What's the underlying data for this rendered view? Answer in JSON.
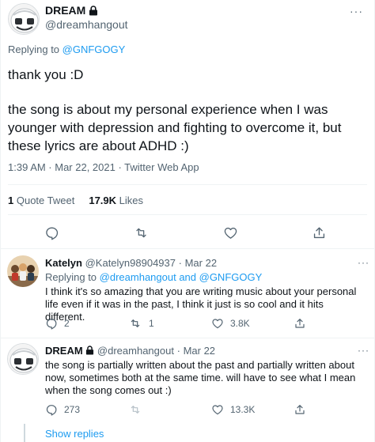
{
  "main_tweet": {
    "author": {
      "display_name": "DREAM",
      "handle": "@dreamhangout",
      "protected_icon": "lock-icon",
      "avatar_icon": "dream-smiley-mask-avatar"
    },
    "more_icon": "more-dots-icon",
    "more_label": "···",
    "replying_prefix": "Replying to",
    "replying_to": "@GNFGOGY",
    "text_line1": "thank you :D",
    "text_line2": "the song is about my personal experience when I was younger with depression and fighting to overcome it, but these lyrics are about ADHD :)",
    "timestamp": "1:39 AM · Mar 22, 2021 · Twitter Web App",
    "stats": {
      "quote_count": "1",
      "quote_label": "Quote Tweet",
      "like_count": "17.9K",
      "like_label": "Likes"
    },
    "actions": [
      "reply-icon",
      "retweet-icon",
      "like-icon",
      "share-icon"
    ]
  },
  "replies": [
    {
      "display_name": "Katelyn",
      "handle": "@Katelyn98904937",
      "sep": "·",
      "date": "Mar 22",
      "replying_prefix": "Replying to",
      "replying_to": "@dreamhangout and @GNFGOGY",
      "text": "I think it's so amazing that you are writing music about your personal life even if it was in the past, I think it just is so cool and it hits different.",
      "more_label": "···",
      "reply_count": "2",
      "retweet_count": "1",
      "like_count": "3.8K",
      "avatar_icon": "group-photo-avatar"
    },
    {
      "display_name": "DREAM",
      "handle": "@dreamhangout",
      "sep": "·",
      "date": "Mar 22",
      "text": "the song is partially written about the past and partially written about now, sometimes both at the same time. will have to see what I mean when the song comes out :)",
      "more_label": "···",
      "reply_count": "273",
      "retweet_count": "",
      "like_count": "13.3K",
      "avatar_icon": "dream-smiley-mask-avatar"
    }
  ],
  "show_replies_label": "Show replies",
  "colors": {
    "accent": "#1d9bf0",
    "secondary_text": "#536471",
    "primary_text": "#0f1419",
    "divider": "#eff3f4"
  }
}
